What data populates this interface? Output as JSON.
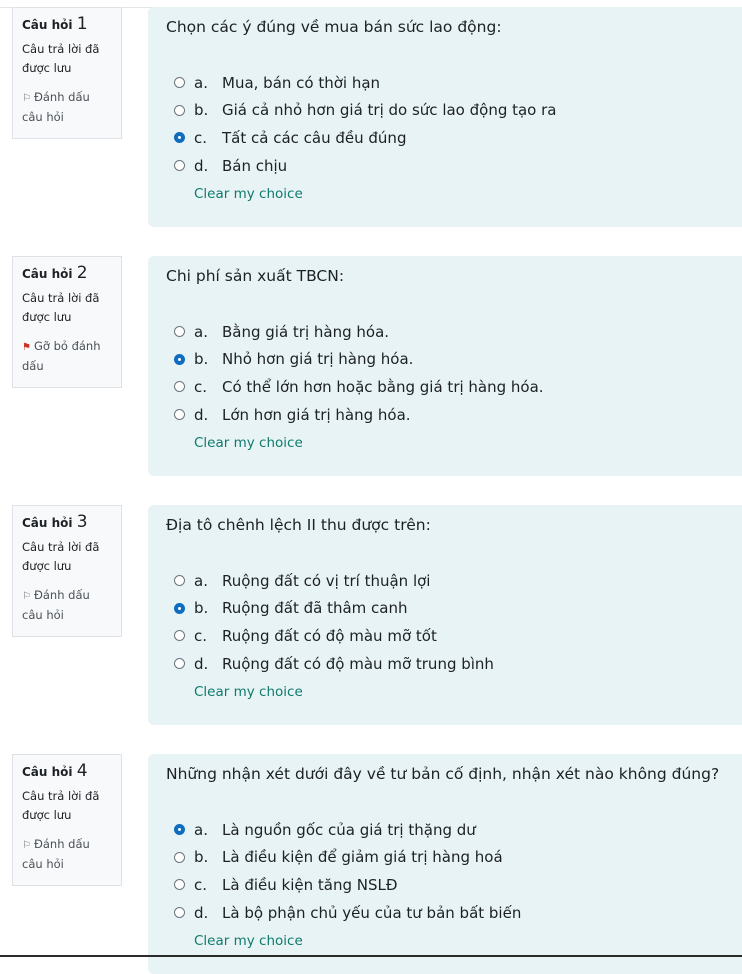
{
  "questions": [
    {
      "label": "Câu hỏi",
      "number": "1",
      "state": "Câu trả lời đã được lưu",
      "flag": {
        "text": "Đánh dấu câu hỏi",
        "icon": "flag-outline-icon"
      },
      "text": "Chọn các ý đúng về mua bán sức lao động:",
      "answers": [
        {
          "letter": "a.",
          "text": "Mua, bán có thời hạn",
          "checked": false
        },
        {
          "letter": "b.",
          "text": "Giá cả nhỏ hơn giá trị do sức lao động tạo ra",
          "checked": false
        },
        {
          "letter": "c.",
          "text": "Tất cả các câu đều đúng",
          "checked": true
        },
        {
          "letter": "d.",
          "text": "Bán chịu",
          "checked": false
        }
      ],
      "clear": "Clear my choice"
    },
    {
      "label": "Câu hỏi",
      "number": "2",
      "state": "Câu trả lời đã được lưu",
      "flag": {
        "text": "Gỡ bỏ đánh dấu",
        "icon": "flag-filled-icon"
      },
      "text": "Chi phí sản xuất TBCN:",
      "answers": [
        {
          "letter": "a.",
          "text": "Bằng giá trị hàng hóa.",
          "checked": false
        },
        {
          "letter": "b.",
          "text": "Nhỏ hơn giá trị hàng hóa.",
          "checked": true
        },
        {
          "letter": "c.",
          "text": "Có thể lớn hơn hoặc bằng giá trị hàng hóa.",
          "checked": false
        },
        {
          "letter": "d.",
          "text": "Lớn hơn giá trị hàng hóa.",
          "checked": false
        }
      ],
      "clear": "Clear my choice"
    },
    {
      "label": "Câu hỏi",
      "number": "3",
      "state": "Câu trả lời đã được lưu",
      "flag": {
        "text": "Đánh dấu câu hỏi",
        "icon": "flag-outline-icon"
      },
      "text": "Địa tô chênh lệch II thu được trên:",
      "answers": [
        {
          "letter": "a.",
          "text": "Ruộng đất có vị trí thuận lợi",
          "checked": false
        },
        {
          "letter": "b.",
          "text": "Ruộng đất đã thâm canh",
          "checked": true
        },
        {
          "letter": "c.",
          "text": "Ruộng đất có độ màu mỡ tốt",
          "checked": false
        },
        {
          "letter": "d.",
          "text": "Ruộng đất có độ màu mỡ trung bình",
          "checked": false
        }
      ],
      "clear": "Clear my choice"
    },
    {
      "label": "Câu hỏi",
      "number": "4",
      "state": "Câu trả lời đã được lưu",
      "flag": {
        "text": "Đánh dấu câu hỏi",
        "icon": "flag-outline-icon"
      },
      "text": "Những nhận xét dưới đây về tư bản cố định, nhận xét nào không đúng?",
      "answers": [
        {
          "letter": "a.",
          "text": "Là nguồn gốc của giá trị thặng dư",
          "checked": true
        },
        {
          "letter": "b.",
          "text": "Là điều kiện để giảm giá trị hàng hoá",
          "checked": false
        },
        {
          "letter": "c.",
          "text": "Là điều kiện tăng NSLĐ",
          "checked": false
        },
        {
          "letter": "d.",
          "text": "Là bộ phận chủ yếu của tư bản bất biến",
          "checked": false
        }
      ],
      "clear": "Clear my choice"
    }
  ],
  "colors": {
    "info_bg": "#f8f9fa",
    "content_bg": "#e7f3f5",
    "radio_checked": "#0f6cbf",
    "link": "#0f7b6c",
    "flag_filled": "#ca3120"
  }
}
